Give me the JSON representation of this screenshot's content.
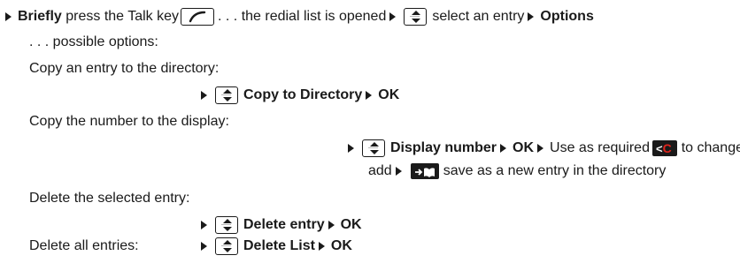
{
  "line1": {
    "briefly": "Briefly",
    "text_a": "press the Talk key",
    "text_b": ". . . the redial list is opened",
    "text_c": "select an entry",
    "options": "Options"
  },
  "possible_options": ". . . possible options:",
  "copy_entry": {
    "heading": "Copy an entry to the directory:",
    "action": "Copy to Directory",
    "ok": "OK"
  },
  "copy_number": {
    "heading": "Copy the number to the display:",
    "action": "Display number",
    "ok": "OK",
    "use_text": "Use as required",
    "change_text": "to change or",
    "add": "add",
    "save_text": "save as a new entry in the directory"
  },
  "delete_entry": {
    "heading": "Delete the selected entry:",
    "action": "Delete entry",
    "ok": "OK"
  },
  "delete_all": {
    "heading": "Delete all entries:",
    "action": "Delete List",
    "ok": "OK"
  },
  "icons": {
    "back_key": "back-delete-key",
    "directory_key": "save-to-directory-key",
    "nav_key": "navigation-key",
    "talk_key": "talk-key"
  }
}
